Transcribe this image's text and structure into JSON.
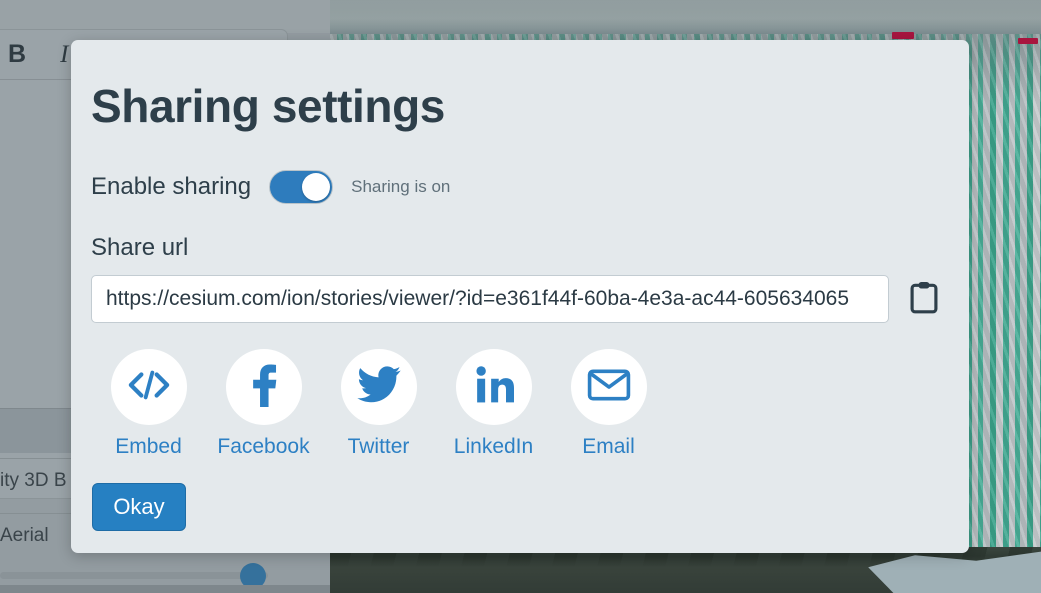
{
  "modal": {
    "title": "Sharing settings",
    "enable_sharing": {
      "label": "Enable sharing",
      "status_text": "Sharing is on",
      "toggle_state": "on",
      "toggle_name": "enable-sharing-toggle"
    },
    "share_url": {
      "label": "Share url",
      "value": "https://cesium.com/ion/stories/viewer/?id=e361f44f-60ba-4e3a-ac44-605634065",
      "placeholder": "Share url",
      "copy_icon": "clipboard-icon"
    },
    "social": [
      {
        "label": "Embed",
        "icon": "code-icon"
      },
      {
        "label": "Facebook",
        "icon": "facebook-icon"
      },
      {
        "label": "Twitter",
        "icon": "twitter-icon"
      },
      {
        "label": "LinkedIn",
        "icon": "linkedin-icon"
      },
      {
        "label": "Email",
        "icon": "envelope-icon"
      }
    ],
    "okay_label": "Okay"
  },
  "background": {
    "editor_toolbar": {
      "bold_label": "B",
      "italic_label": "I"
    },
    "layer_rows": [
      {
        "label": ""
      },
      {
        "label": "ity 3D B"
      },
      {
        "label": "Aerial"
      }
    ]
  },
  "colors": {
    "modal_bg": "#e4e9ec",
    "accent_blue": "#2680c2",
    "toggle_on": "#2e7cbd",
    "title_text": "#2e3f4a",
    "link_blue": "#2d80c4",
    "dim_panel": "#939ca1",
    "map_building_teal": "#3fae94"
  }
}
